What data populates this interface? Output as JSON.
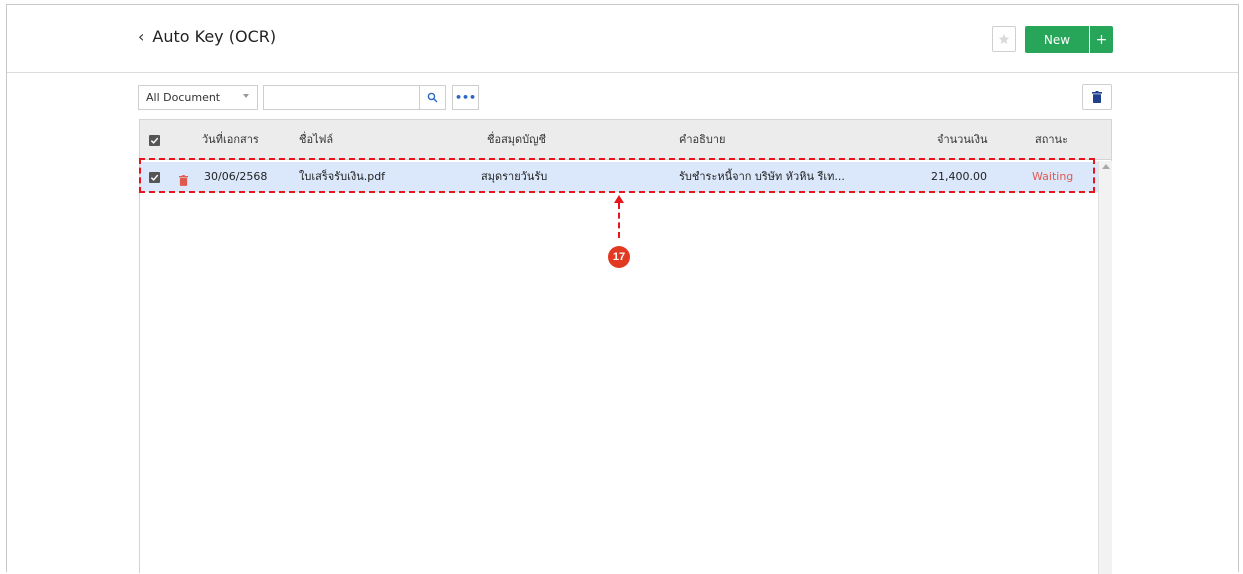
{
  "header": {
    "back_icon": "chevron-left-icon",
    "title": "Auto Key (OCR)",
    "favorite_icon": "star-icon",
    "new_label": "New",
    "new_plus_label": "+",
    "accent_color": "#27a65a"
  },
  "toolbar": {
    "filter_selected": "All Document",
    "search_value": "",
    "search_placeholder": "",
    "search_icon": "search-icon",
    "more_label": "•••",
    "delete_icon": "trash-icon",
    "delete_icon_color": "#1f3f8f"
  },
  "table": {
    "columns": [
      "วันที่เอกสาร",
      "ชื่อไฟล์",
      "ชื่อสมุดบัญชี",
      "คำอธิบาย",
      "จำนวนเงิน",
      "สถานะ"
    ],
    "rows": [
      {
        "checked": true,
        "date": "30/06/2568",
        "file_name": "ใบเสร็จรับเงิน.pdf",
        "book_name": "สมุดรายวันรับ",
        "description": "รับชำระหนี้จาก บริษัท หัวหิน รีเท...",
        "amount": "21,400.00",
        "status": "Waiting",
        "status_color": "#e0594f"
      }
    ],
    "selected_row_color": "#dbe8fb"
  },
  "annotation": {
    "step_number": "17",
    "highlight_color": "#e8141b"
  }
}
